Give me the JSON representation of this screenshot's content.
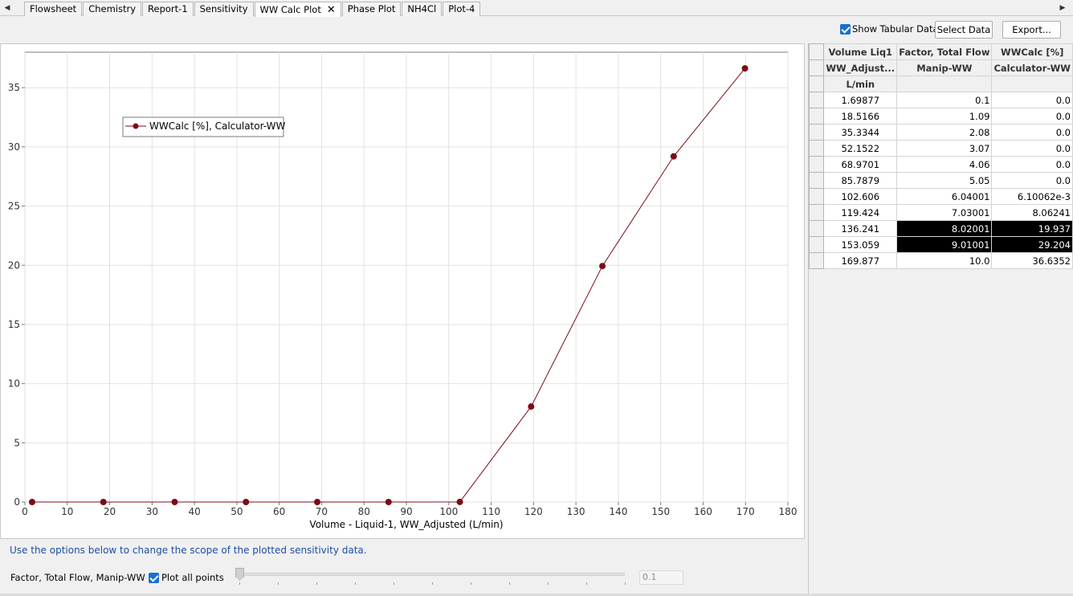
{
  "tabs": [
    {
      "label": "Flowsheet"
    },
    {
      "label": "Chemistry"
    },
    {
      "label": "Report-1"
    },
    {
      "label": "Sensitivity"
    },
    {
      "label": "WW Calc Plot",
      "active": true
    },
    {
      "label": "Phase Plot"
    },
    {
      "label": "NH4Cl"
    },
    {
      "label": "Plot-4"
    }
  ],
  "toolbar": {
    "show_tabular_label": "Show Tabular Data",
    "show_tabular_checked": true,
    "select_data_label": "Select Data",
    "export_label": "Export..."
  },
  "chart_data": {
    "type": "line",
    "xlabel": "Volume - Liquid-1, WW_Adjusted (L/min)",
    "ylabel": "",
    "title": "",
    "xlim": [
      0,
      180
    ],
    "ylim": [
      0,
      38
    ],
    "xticks": [
      0,
      10,
      20,
      30,
      40,
      50,
      60,
      70,
      80,
      90,
      100,
      110,
      120,
      130,
      140,
      150,
      160,
      170,
      180
    ],
    "yticks": [
      0,
      5,
      10,
      15,
      20,
      25,
      30,
      35
    ],
    "grid": true,
    "legend_position": "top-left",
    "series": [
      {
        "name": "WWCalc [%], Calculator-WW",
        "color": "#7b0c17",
        "x": [
          1.69877,
          18.5166,
          35.3344,
          52.1522,
          68.9701,
          85.7879,
          102.606,
          119.424,
          136.241,
          153.059,
          169.877
        ],
        "y": [
          0.0,
          0.0,
          0.0,
          0.0,
          0.0,
          0.0,
          0.00610062,
          8.06241,
          19.937,
          29.204,
          36.6352
        ]
      }
    ]
  },
  "table": {
    "headers": [
      [
        "Volume Liq1",
        "Factor, Total Flow",
        "WWCalc [%]"
      ],
      [
        "WW_Adjust...",
        "Manip-WW",
        "Calculator-WW"
      ],
      [
        "L/min",
        "",
        ""
      ]
    ],
    "rows": [
      [
        "1.69877",
        "0.1",
        "0.0"
      ],
      [
        "18.5166",
        "1.09",
        "0.0"
      ],
      [
        "35.3344",
        "2.08",
        "0.0"
      ],
      [
        "52.1522",
        "3.07",
        "0.0"
      ],
      [
        "68.9701",
        "4.06",
        "0.0"
      ],
      [
        "85.7879",
        "5.05",
        "0.0"
      ],
      [
        "102.606",
        "6.04001",
        "6.10062e-3"
      ],
      [
        "119.424",
        "7.03001",
        "8.06241"
      ],
      [
        "136.241",
        "8.02001",
        "19.937"
      ],
      [
        "153.059",
        "9.01001",
        "29.204"
      ],
      [
        "169.877",
        "10.0",
        "36.6352"
      ]
    ],
    "selected_rows": [
      8,
      9
    ]
  },
  "bottom": {
    "hint": "Use the options below to change the scope of the plotted sensitivity data.",
    "scope_label": "Factor, Total Flow, Manip-WW",
    "plot_all_label": "Plot all points",
    "plot_all_checked": true,
    "slider_value": "0.1"
  }
}
